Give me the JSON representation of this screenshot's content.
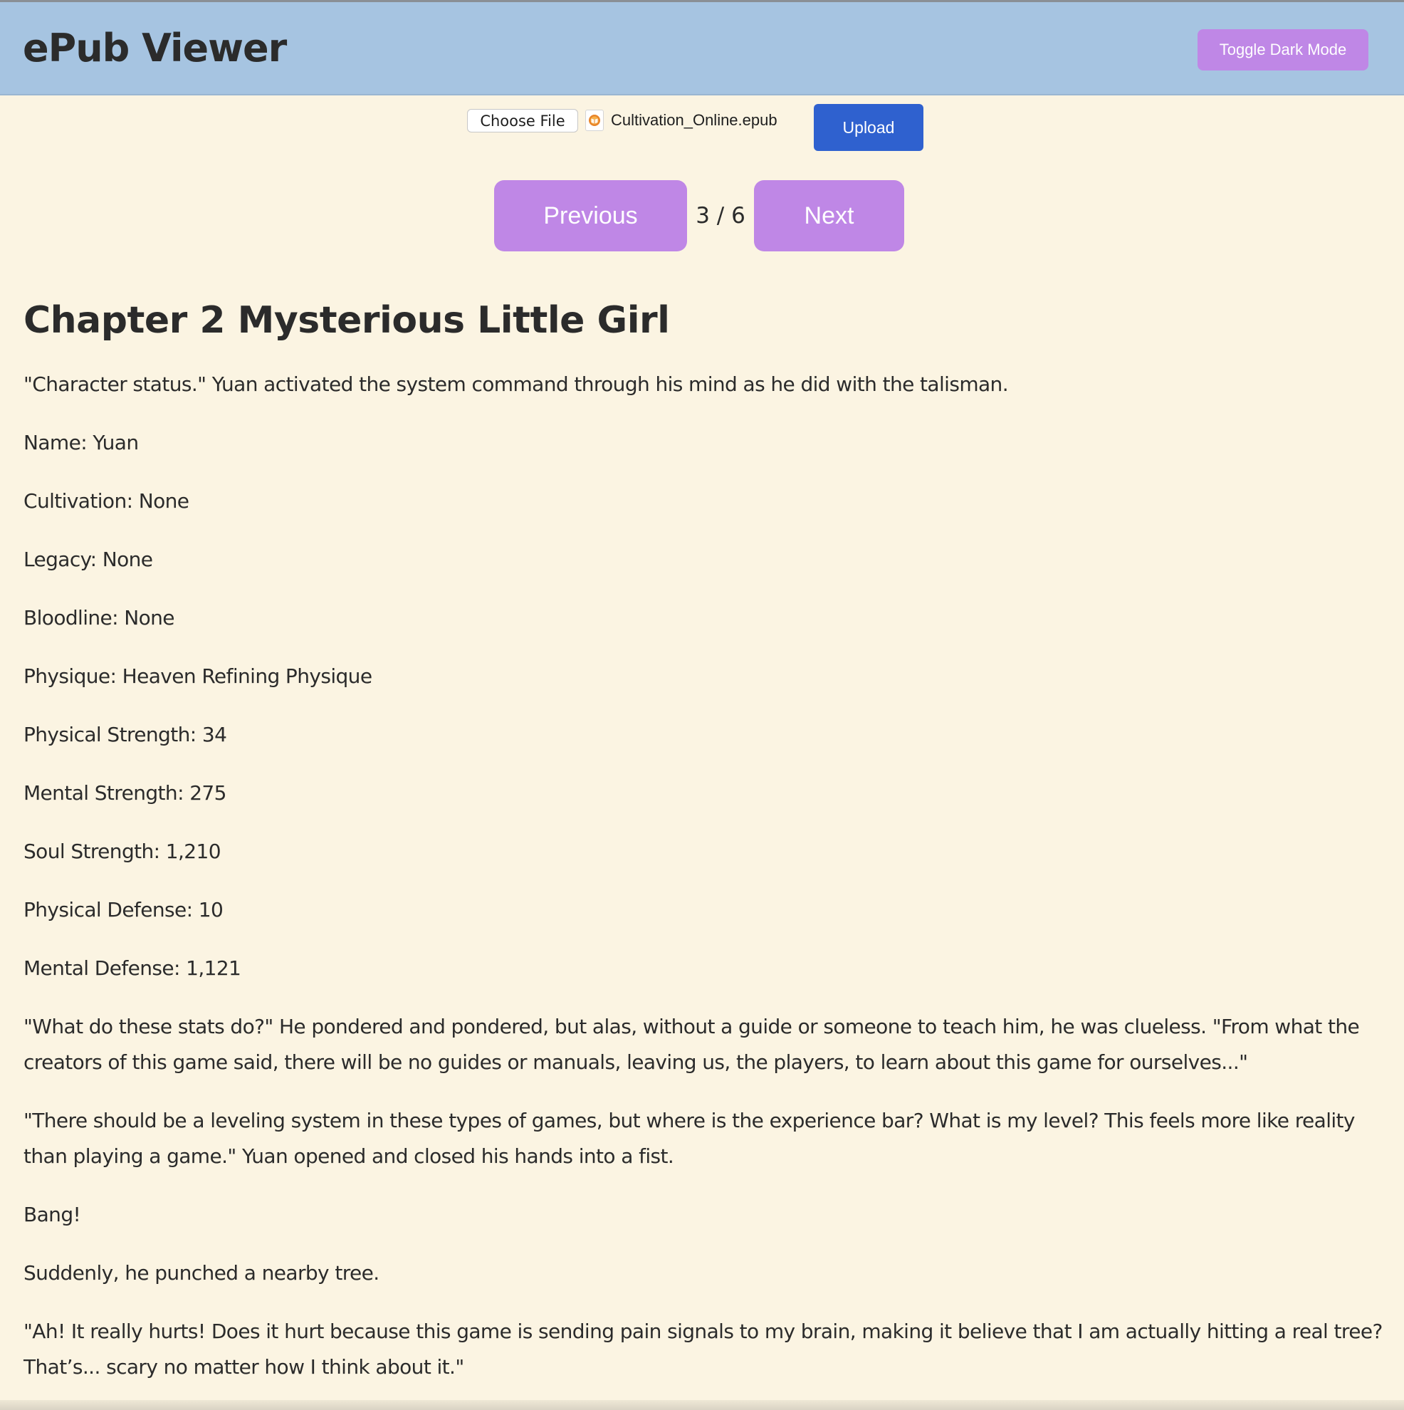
{
  "app": {
    "title": "ePub Viewer",
    "toggle_dark_mode_label": "Toggle Dark Mode"
  },
  "upload": {
    "choose_file_label": "Choose File",
    "file_icon": "book-file-icon",
    "file_name": "Cultivation_Online.epub",
    "upload_label": "Upload"
  },
  "navigation": {
    "previous_label": "Previous",
    "page_indicator": "3 / 6",
    "next_label": "Next"
  },
  "chapter": {
    "title": "Chapter 2 Mysterious Little Girl",
    "paragraphs": [
      "\"Character status.\" Yuan activated the system command through his mind as he did with the talisman.",
      "Name: Yuan",
      "Cultivation: None",
      "Legacy: None",
      "Bloodline: None",
      "Physique: Heaven Refining Physique",
      "Physical Strength: 34",
      "Mental Strength: 275",
      "Soul Strength: 1,210",
      "Physical Defense: 10",
      "Mental Defense: 1,121",
      "\"What do these stats do?\" He pondered and pondered, but alas, without a guide or someone to teach him, he was clueless. \"From what the creators of this game said, there will be no guides or manuals, leaving us, the players, to learn about this game for ourselves...\"",
      "\"There should be a leveling system in these types of games, but where is the experience bar? What is my level? This feels more like reality than playing a game.\" Yuan opened and closed his hands into a fist.",
      "Bang!",
      "Suddenly, he punched a nearby tree.",
      "\"Ah! It really hurts! Does it hurt because this game is sending pain signals to my brain, making it believe that I am actually hitting a real tree? That’s... scary no matter how I think about it.\""
    ]
  },
  "colors": {
    "header_background": "#a6c4e1",
    "page_background": "#fbf4e2",
    "accent_purple": "#bf87e6",
    "upload_blue": "#2f61cf",
    "text": "#2b2b2b"
  }
}
